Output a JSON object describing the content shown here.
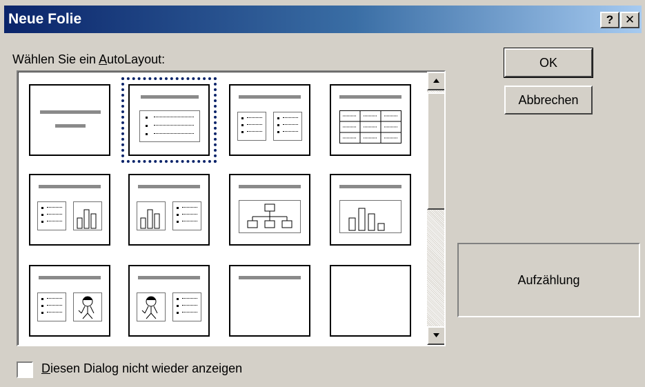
{
  "window": {
    "title": "Neue Folie",
    "help_label": "?",
    "close_label": "✕"
  },
  "layout_prompt": {
    "before": "Wählen Sie ein ",
    "accel": "A",
    "after": "utoLayout:"
  },
  "layouts": [
    {
      "id": "title-slide",
      "selected": false
    },
    {
      "id": "bulleted-list",
      "selected": true
    },
    {
      "id": "two-column-text",
      "selected": false
    },
    {
      "id": "table",
      "selected": false
    },
    {
      "id": "text-and-chart",
      "selected": false
    },
    {
      "id": "chart-and-text",
      "selected": false
    },
    {
      "id": "organization-chart",
      "selected": false
    },
    {
      "id": "chart",
      "selected": false
    },
    {
      "id": "text-and-clip-art",
      "selected": false
    },
    {
      "id": "clip-art-and-text",
      "selected": false
    },
    {
      "id": "title-only",
      "selected": false
    },
    {
      "id": "blank",
      "selected": false
    }
  ],
  "buttons": {
    "ok": "OK",
    "cancel": "Abbrechen"
  },
  "preview": {
    "label": "Aufzählung"
  },
  "checkbox": {
    "accel": "D",
    "rest": "iesen Dialog nicht wieder anzeigen",
    "checked": false
  },
  "colors": {
    "title_gradient_start": "#0a246a",
    "title_gradient_end": "#a6caf0",
    "dialog_bg": "#d4d0c8"
  }
}
